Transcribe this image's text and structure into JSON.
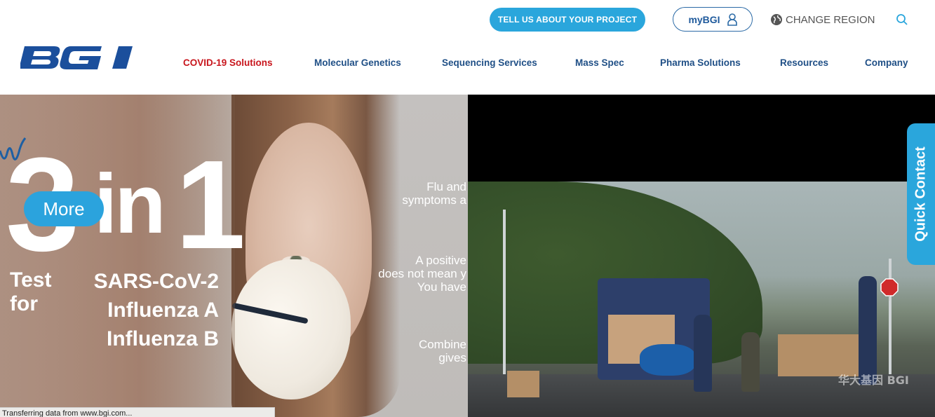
{
  "header": {
    "cta_label": "TELL US ABOUT YOUR PROJECT",
    "mybgi_label": "myBGI",
    "region_label": "CHANGE REGION",
    "logo_text": "BGI"
  },
  "nav": {
    "items": [
      {
        "label": "COVID-19 Solutions",
        "active": true
      },
      {
        "label": "Molecular Genetics"
      },
      {
        "label": "Sequencing Services"
      },
      {
        "label": "Mass Spec"
      },
      {
        "label": "Pharma Solutions"
      },
      {
        "label": "Resources"
      },
      {
        "label": "Company"
      }
    ]
  },
  "hero": {
    "big_three": "3",
    "big_in": "in",
    "big_one": "1",
    "more_label": "More",
    "test_for": "Test\nfor",
    "viruses": [
      "SARS-CoV-2",
      "Influenza A",
      "Influenza B"
    ],
    "right_text_1": [
      "Flu and",
      "symptoms a"
    ],
    "right_text_2": [
      "A positive",
      "does not mean y",
      "You have"
    ],
    "right_text_3": [
      "Combine",
      "gives"
    ]
  },
  "video": {
    "watermark": "华大基因 BGI"
  },
  "quick_contact_label": "Quick Contact",
  "status_bar_text": "Transferring data from www.bgi.com...",
  "colors": {
    "accent_blue": "#2aa6dc",
    "nav_blue": "#1f4f86",
    "active_red": "#c8161d",
    "logo_blue": "#1b4f9c"
  }
}
